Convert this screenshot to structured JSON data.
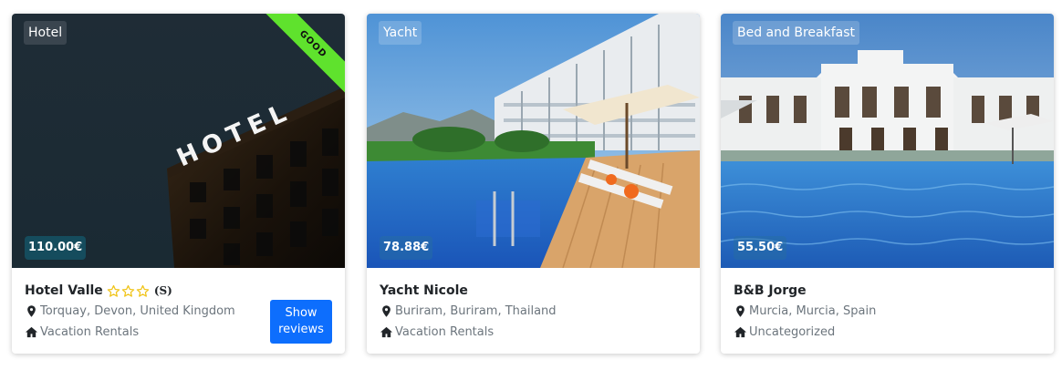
{
  "listings": [
    {
      "type": "Hotel",
      "price": "110.00€",
      "ribbon": "GOOD",
      "name": "Hotel Valle",
      "star_count": 3,
      "rating_note": "(S)",
      "location": "Torquay, Devon, United Kingdom",
      "category": "Vacation Rentals",
      "show_reviews_label": "Show reviews"
    },
    {
      "type": "Yacht",
      "price": "78.88€",
      "name": "Yacht Nicole",
      "location": "Buriram, Buriram, Thailand",
      "category": "Vacation Rentals"
    },
    {
      "type": "Bed and Breakfast",
      "price": "55.50€",
      "name": "B&B Jorge",
      "location": "Murcia, Murcia, Spain",
      "category": "Uncategorized"
    }
  ],
  "icons": {
    "location": "map-marker-icon",
    "category": "home-icon",
    "star": "star-outline-icon"
  },
  "colors": {
    "button": "#0d6efd",
    "ribbon": "#5fe22d",
    "star": "#f0c419"
  }
}
